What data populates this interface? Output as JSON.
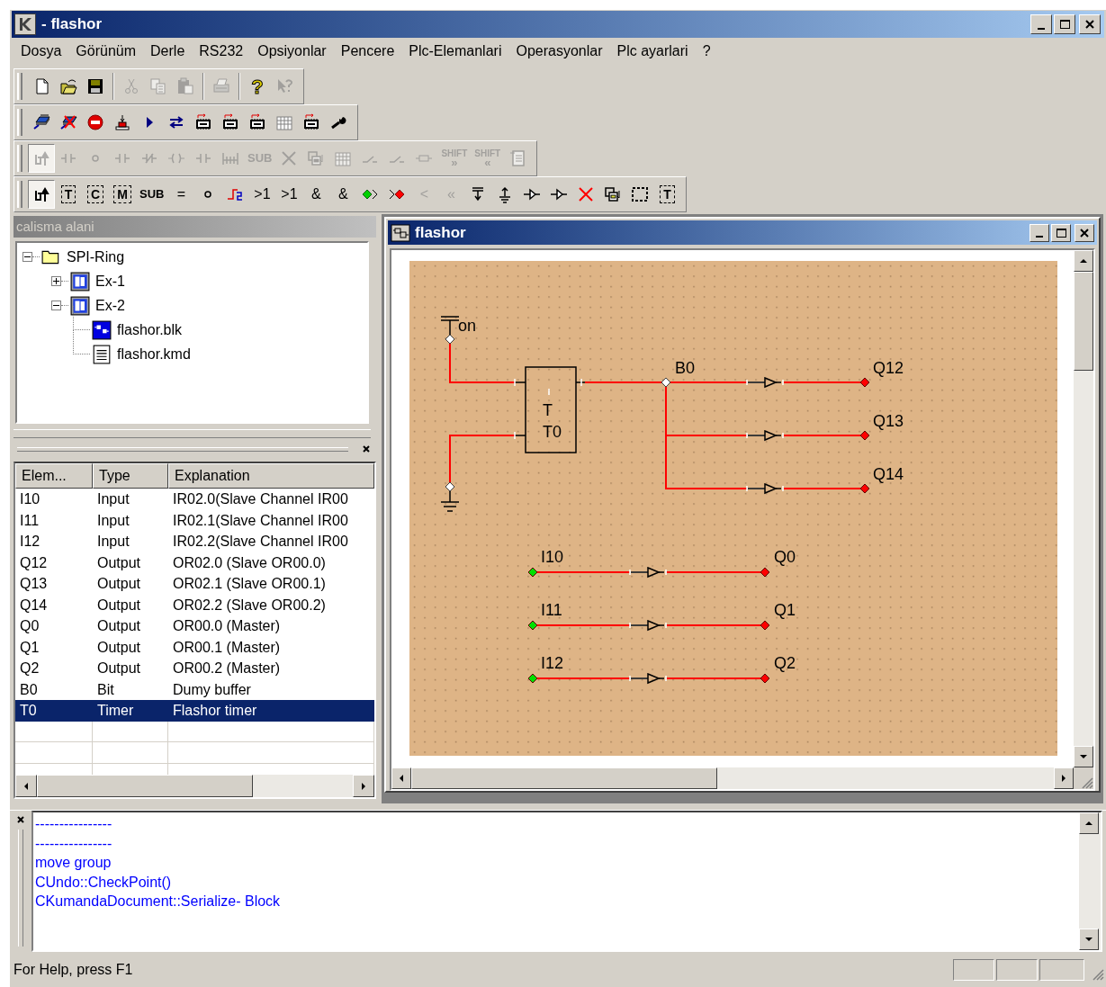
{
  "window": {
    "title": "- flashor"
  },
  "menu": [
    "Dosya",
    "Görünüm",
    "Derle",
    "RS232",
    "Opsiyonlar",
    "Pencere",
    "Plc-Elemanlari",
    "Operasyonlar",
    "Plc ayarlari",
    "?"
  ],
  "toolbars": [
    {
      "items": [
        {
          "kind": "new",
          "disabled": false,
          "pressed": false
        },
        {
          "kind": "open",
          "disabled": false,
          "pressed": false
        },
        {
          "kind": "save",
          "disabled": false,
          "pressed": false
        },
        {
          "kind": "sep"
        },
        {
          "kind": "cut",
          "disabled": true,
          "pressed": false
        },
        {
          "kind": "copy",
          "disabled": true,
          "pressed": false
        },
        {
          "kind": "paste",
          "disabled": true,
          "pressed": false
        },
        {
          "kind": "sep"
        },
        {
          "kind": "print",
          "disabled": true,
          "pressed": false
        },
        {
          "kind": "sep"
        },
        {
          "kind": "text",
          "label": "?",
          "disabled": false,
          "pressed": false
        },
        {
          "kind": "whatsthis",
          "disabled": true,
          "pressed": false
        }
      ]
    },
    {
      "items": [
        {
          "kind": "link",
          "disabled": false,
          "pressed": false
        },
        {
          "kind": "unlink",
          "disabled": false,
          "pressed": false
        },
        {
          "kind": "stop",
          "disabled": false,
          "pressed": false
        },
        {
          "kind": "beacon",
          "disabled": false,
          "pressed": false
        },
        {
          "kind": "play",
          "disabled": false,
          "pressed": false
        },
        {
          "kind": "swap",
          "disabled": false,
          "pressed": false
        },
        {
          "kind": "chip",
          "disabled": false,
          "pressed": false
        },
        {
          "kind": "chip",
          "disabled": false,
          "pressed": false
        },
        {
          "kind": "chip",
          "disabled": false,
          "pressed": false
        },
        {
          "kind": "grid",
          "disabled": false,
          "pressed": false
        },
        {
          "kind": "chip",
          "disabled": false,
          "pressed": false
        },
        {
          "kind": "wrench",
          "disabled": false,
          "pressed": false
        }
      ]
    },
    {
      "items": [
        {
          "kind": "pointer",
          "disabled": true,
          "pressed": true
        },
        {
          "kind": "contact",
          "disabled": true,
          "pressed": false
        },
        {
          "kind": "circle",
          "disabled": true,
          "pressed": false
        },
        {
          "kind": "contact",
          "disabled": true,
          "pressed": false
        },
        {
          "kind": "contactx",
          "disabled": true,
          "pressed": false
        },
        {
          "kind": "coil",
          "disabled": true,
          "pressed": false
        },
        {
          "kind": "contact",
          "disabled": true,
          "pressed": false
        },
        {
          "kind": "bus",
          "disabled": true,
          "pressed": false
        },
        {
          "kind": "text",
          "label": "SUB",
          "disabled": true,
          "pressed": false
        },
        {
          "kind": "cross",
          "disabled": true,
          "pressed": false
        },
        {
          "kind": "copyframe",
          "disabled": true,
          "pressed": false
        },
        {
          "kind": "grid",
          "disabled": true,
          "pressed": false
        },
        {
          "kind": "switch",
          "disabled": true,
          "pressed": false
        },
        {
          "kind": "switch",
          "disabled": true,
          "pressed": false
        },
        {
          "kind": "resistor",
          "disabled": true,
          "pressed": false
        },
        {
          "kind": "shift",
          "label": "SHIFT",
          "sub": "»",
          "disabled": true,
          "pressed": false
        },
        {
          "kind": "shift",
          "label": "SHIFT",
          "sub": "«",
          "disabled": true,
          "pressed": false
        },
        {
          "kind": "doc",
          "disabled": true,
          "pressed": false
        }
      ]
    },
    {
      "items": [
        {
          "kind": "pointer",
          "disabled": false,
          "pressed": true
        },
        {
          "kind": "block",
          "label": "T",
          "disabled": false,
          "pressed": false
        },
        {
          "kind": "block",
          "label": "C",
          "disabled": false,
          "pressed": false
        },
        {
          "kind": "block",
          "label": "M",
          "disabled": false,
          "pressed": false
        },
        {
          "kind": "text",
          "label": "SUB",
          "disabled": false,
          "pressed": false
        },
        {
          "kind": "text",
          "label": "=",
          "disabled": false,
          "pressed": false
        },
        {
          "kind": "circle",
          "disabled": false,
          "pressed": false
        },
        {
          "kind": "pulse",
          "disabled": false,
          "pressed": false
        },
        {
          "kind": "text",
          "label": ">1",
          "disabled": false,
          "pressed": false
        },
        {
          "kind": "text",
          "label": ">1",
          "disabled": false,
          "pressed": false
        },
        {
          "kind": "text",
          "label": "&",
          "disabled": false,
          "pressed": false
        },
        {
          "kind": "text",
          "label": "&",
          "disabled": false,
          "pressed": false
        },
        {
          "kind": "diamondin",
          "disabled": false,
          "pressed": false
        },
        {
          "kind": "diamondout",
          "disabled": false,
          "pressed": false
        },
        {
          "kind": "text",
          "label": "<",
          "disabled": true,
          "pressed": false
        },
        {
          "kind": "text",
          "label": "«",
          "disabled": true,
          "pressed": false
        },
        {
          "kind": "power",
          "disabled": false,
          "pressed": false
        },
        {
          "kind": "ground",
          "disabled": false,
          "pressed": false
        },
        {
          "kind": "buffer",
          "disabled": false,
          "pressed": false
        },
        {
          "kind": "buffer",
          "disabled": false,
          "pressed": false
        },
        {
          "kind": "redx",
          "disabled": false,
          "pressed": false
        },
        {
          "kind": "copyframe",
          "disabled": false,
          "pressed": false
        },
        {
          "kind": "selrect",
          "disabled": false,
          "pressed": false
        },
        {
          "kind": "block",
          "label": "T",
          "disabled": false,
          "pressed": false
        }
      ]
    }
  ],
  "workspace": {
    "title": "calisma alani",
    "tree": [
      {
        "label": "SPI-Ring",
        "kind": "folder",
        "expanded": true,
        "children": [
          {
            "label": "Ex-1",
            "kind": "project",
            "expanded": false
          },
          {
            "label": "Ex-2",
            "kind": "project",
            "expanded": true,
            "children": [
              {
                "label": "flashor.blk",
                "kind": "block"
              },
              {
                "label": "flashor.kmd",
                "kind": "file"
              }
            ]
          }
        ]
      }
    ]
  },
  "elements": {
    "columns": [
      "Elem...",
      "Type",
      "Explanation"
    ],
    "rows": [
      {
        "cells": [
          "I10",
          "Input",
          "IR02.0(Slave Channel IR00"
        ],
        "selected": false
      },
      {
        "cells": [
          "I11",
          "Input",
          "IR02.1(Slave Channel IR00"
        ],
        "selected": false
      },
      {
        "cells": [
          "I12",
          "Input",
          "IR02.2(Slave Channel IR00"
        ],
        "selected": false
      },
      {
        "cells": [
          "Q12",
          "Output",
          "OR02.0 (Slave OR00.0)"
        ],
        "selected": false
      },
      {
        "cells": [
          "Q13",
          "Output",
          "OR02.1 (Slave OR00.1)"
        ],
        "selected": false
      },
      {
        "cells": [
          "Q14",
          "Output",
          "OR02.2 (Slave OR00.2)"
        ],
        "selected": false
      },
      {
        "cells": [
          "Q0",
          "Output",
          "OR00.0 (Master)"
        ],
        "selected": false
      },
      {
        "cells": [
          "Q1",
          "Output",
          "OR00.1 (Master)"
        ],
        "selected": false
      },
      {
        "cells": [
          "Q2",
          "Output",
          "OR00.2 (Master)"
        ],
        "selected": false
      },
      {
        "cells": [
          "B0",
          "Bit",
          "Dumy buffer"
        ],
        "selected": false
      },
      {
        "cells": [
          "T0",
          "Timer",
          "Flashor timer"
        ],
        "selected": true
      }
    ]
  },
  "document": {
    "title": "flashor",
    "diagram": {
      "source": "on",
      "timer_type": "T",
      "timer_name": "T0",
      "node": "B0",
      "outputs": [
        "Q12",
        "Q13",
        "Q14"
      ],
      "rungs": [
        {
          "input": "I10",
          "output": "Q0"
        },
        {
          "input": "I11",
          "output": "Q1"
        },
        {
          "input": "I12",
          "output": "Q2"
        }
      ]
    }
  },
  "output": [
    "----------------",
    "----------------",
    "move group",
    "CUndo::CheckPoint()",
    "CKumandaDocument::Serialize- Block"
  ],
  "status_bar": {
    "text": "For Help, press F1"
  }
}
